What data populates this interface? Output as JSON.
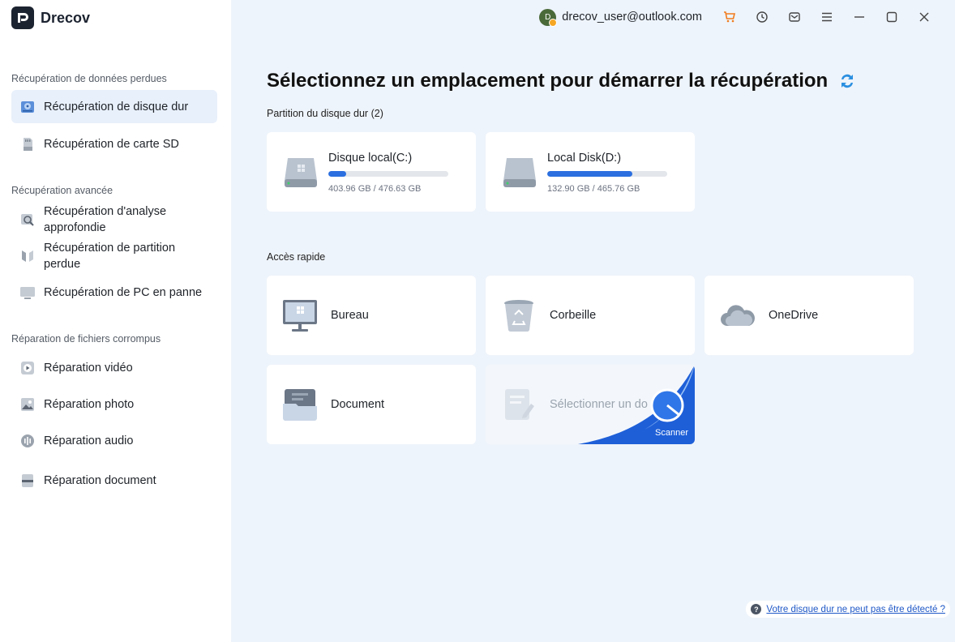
{
  "app": {
    "name": "Drecov"
  },
  "user": {
    "avatar_letter": "D",
    "email": "drecov_user@outlook.com"
  },
  "toolbar": {
    "icons": [
      "cart-icon",
      "history-icon",
      "mail-icon",
      "menu-icon",
      "minimize-icon",
      "maximize-icon",
      "close-icon"
    ],
    "accent": "#f07b1d"
  },
  "sidebar": {
    "sections": [
      {
        "title": "Récupération de données perdues",
        "items": [
          {
            "label": "Récupération de disque dur",
            "active": true
          },
          {
            "label": "Récupération de carte SD"
          }
        ]
      },
      {
        "title": "Récupération avancée",
        "items": [
          {
            "label": "Récupération d'analyse approfondie"
          },
          {
            "label": "Récupération de partition perdue"
          },
          {
            "label": "Récupération de PC en panne"
          }
        ]
      },
      {
        "title": "Réparation de fichiers corrompus",
        "items": [
          {
            "label": "Réparation vidéo"
          },
          {
            "label": "Réparation photo"
          },
          {
            "label": "Réparation audio"
          },
          {
            "label": "Réparation document"
          }
        ]
      }
    ]
  },
  "main": {
    "title": "Sélectionnez un emplacement pour démarrer la récupération",
    "partitions_label": "Partition du disque dur",
    "partitions_count": "(2)",
    "disks": [
      {
        "name": "Disque local(C:)",
        "size": "403.96 GB / 476.63 GB",
        "used_fraction": 0.15
      },
      {
        "name": "Local Disk(D:)",
        "size": "132.90 GB / 465.76 GB",
        "used_fraction": 0.71
      }
    ],
    "quick_access_label": "Accès rapide",
    "quick_access": [
      {
        "label": "Bureau",
        "icon": "desktop-icon"
      },
      {
        "label": "Corbeille",
        "icon": "recycle-bin-icon"
      },
      {
        "label": "OneDrive",
        "icon": "cloud-icon"
      },
      {
        "label": "Document",
        "icon": "folder-icon"
      },
      {
        "label": "Sélectionner un do",
        "icon": "select-folder-icon",
        "disabled": true
      }
    ],
    "scan_label": "Scanner",
    "help_text": "Votre disque dur ne peut pas être détecté ?",
    "accent_color": "#2b6fe0"
  }
}
